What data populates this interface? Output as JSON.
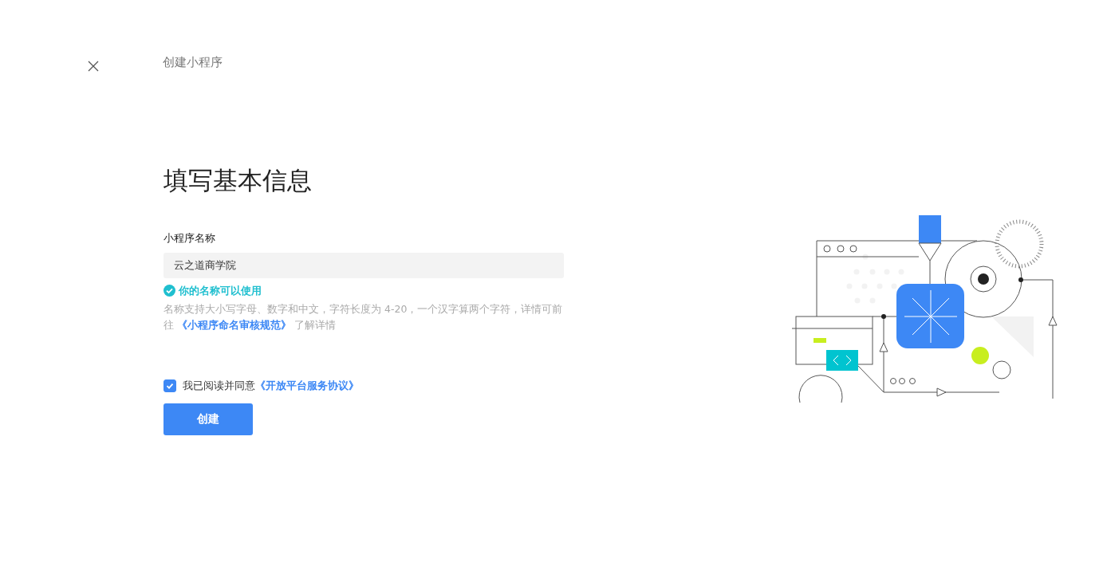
{
  "header": {
    "title": "创建小程序"
  },
  "form": {
    "heading": "填写基本信息",
    "name_field": {
      "label": "小程序名称",
      "value": "云之道商学院"
    },
    "validation": {
      "ok": true,
      "text": "你的名称可以使用"
    },
    "hint": {
      "before": "名称支持大小写字母、数字和中文，字符长度为 4-20，一个汉字算两个字符，详情可前往",
      "link": "《小程序命名审核规范》",
      "after": "了解详情"
    },
    "agreement": {
      "checked": true,
      "text": "我已阅读并同意",
      "link": "《开放平台服务协议》"
    },
    "submit": {
      "label": "创建"
    }
  }
}
